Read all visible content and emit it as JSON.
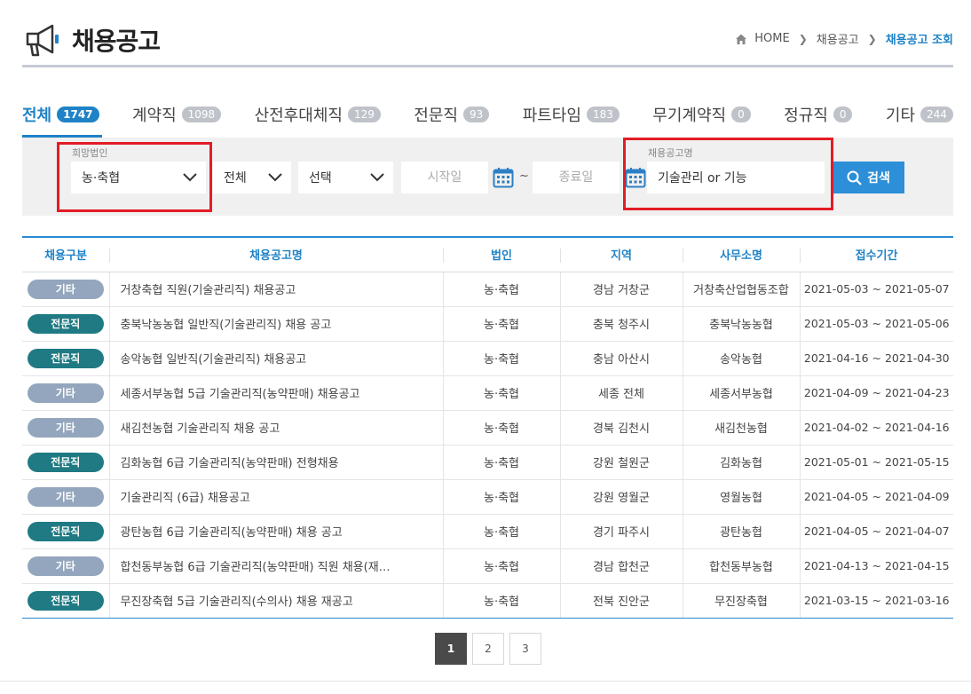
{
  "header": {
    "title": "채용공고",
    "breadcrumb": {
      "home": "HOME",
      "level1": "채용공고",
      "current": "채용공고 조회"
    }
  },
  "tabs": [
    {
      "label": "전체",
      "count": "1747",
      "active": true
    },
    {
      "label": "계약직",
      "count": "1098"
    },
    {
      "label": "산전후대체직",
      "count": "129"
    },
    {
      "label": "전문직",
      "count": "93"
    },
    {
      "label": "파트타임",
      "count": "183"
    },
    {
      "label": "무기계약직",
      "count": "0"
    },
    {
      "label": "정규직",
      "count": "0"
    },
    {
      "label": "기타",
      "count": "244"
    }
  ],
  "search": {
    "corp_label": "희망법인",
    "corp_value": "농·축협",
    "region_value": "전체",
    "sub_value": "선택",
    "start_placeholder": "시작일",
    "tilde": "~",
    "end_placeholder": "종료일",
    "keyword_label": "채용공고명",
    "keyword_value": "기술관리 or 기능",
    "button_label": "검색"
  },
  "table": {
    "headers": [
      "채용구분",
      "채용공고명",
      "법인",
      "지역",
      "사무소명",
      "접수기간"
    ],
    "rows": [
      {
        "type": "기타",
        "title": "거창축협 직원(기술관리직) 채용공고",
        "corp": "농·축협",
        "region": "경남 거창군",
        "office": "거창축산업협동조합",
        "period": "2021-05-03 ~ 2021-05-07"
      },
      {
        "type": "전문직",
        "title": "충북낙농농협 일반직(기술관리직) 채용 공고",
        "corp": "농·축협",
        "region": "충북 청주시",
        "office": "충북낙농농협",
        "period": "2021-05-03 ~ 2021-05-06"
      },
      {
        "type": "전문직",
        "title": "송악농협 일반직(기술관리직) 채용공고",
        "corp": "농·축협",
        "region": "충남 아산시",
        "office": "송악농협",
        "period": "2021-04-16 ~ 2021-04-30"
      },
      {
        "type": "기타",
        "title": "세종서부농협 5급 기술관리직(농약판매) 채용공고",
        "corp": "농·축협",
        "region": "세종 전체",
        "office": "세종서부농협",
        "period": "2021-04-09 ~ 2021-04-23"
      },
      {
        "type": "기타",
        "title": "새김천농협 기술관리직 채용 공고",
        "corp": "농·축협",
        "region": "경북 김천시",
        "office": "새김천농협",
        "period": "2021-04-02 ~ 2021-04-16"
      },
      {
        "type": "전문직",
        "title": "김화농협 6급 기술관리직(농약판매) 전형채용",
        "corp": "농·축협",
        "region": "강원 철원군",
        "office": "김화농협",
        "period": "2021-05-01 ~ 2021-05-15"
      },
      {
        "type": "기타",
        "title": "기술관리직 (6급) 채용공고",
        "corp": "농·축협",
        "region": "강원 영월군",
        "office": "영월농협",
        "period": "2021-04-05 ~ 2021-04-09"
      },
      {
        "type": "전문직",
        "title": "광탄농협 6급 기술관리직(농약판매) 채용 공고",
        "corp": "농·축협",
        "region": "경기 파주시",
        "office": "광탄농협",
        "period": "2021-04-05 ~ 2021-04-07"
      },
      {
        "type": "기타",
        "title": "합천동부농협 6급 기술관리직(농약판매) 직원 채용(재…",
        "corp": "농·축협",
        "region": "경남 합천군",
        "office": "합천동부농협",
        "period": "2021-04-13 ~ 2021-04-15"
      },
      {
        "type": "전문직",
        "title": "무진장축협 5급 기술관리직(수의사) 채용 재공고",
        "corp": "농·축협",
        "region": "전북 진안군",
        "office": "무진장축협",
        "period": "2021-03-15 ~ 2021-03-16"
      }
    ]
  },
  "pagination": [
    "1",
    "2",
    "3"
  ],
  "colors": {
    "accent": "#1f82c6",
    "badge_etc": "#94a6bd",
    "badge_pro": "#1f7a83",
    "highlight": "#e31c25"
  },
  "icons": [
    "megaphone-icon",
    "home-icon",
    "chevron-right-icon",
    "chevron-down-icon",
    "calendar-icon",
    "search-icon"
  ]
}
